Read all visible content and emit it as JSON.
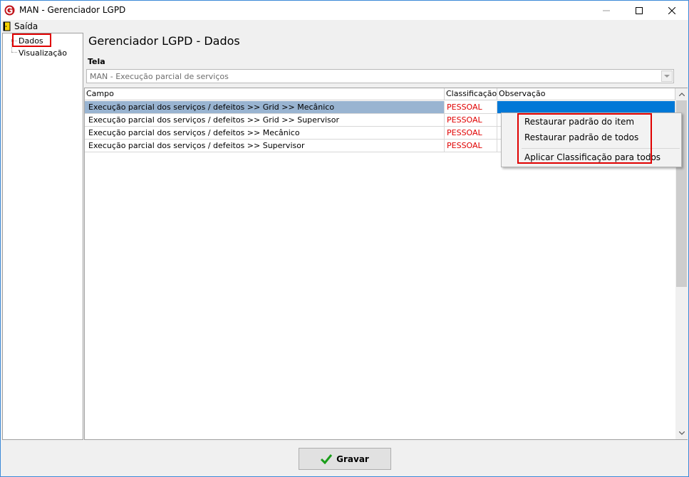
{
  "window": {
    "title": "MAN - Gerenciador LGPD"
  },
  "menubar": {
    "exit_label": "Saída"
  },
  "tree": {
    "items": [
      {
        "label": "Dados"
      },
      {
        "label": "Visualização"
      }
    ]
  },
  "main": {
    "title": "Gerenciador LGPD - Dados",
    "tela_label": "Tela",
    "tela_value": "MAN - Execução parcial de serviços"
  },
  "grid": {
    "columns": [
      "Campo",
      "Classificação",
      "Observação"
    ],
    "rows": [
      {
        "campo": "Execução parcial dos serviços / defeitos >> Grid >> Mecânico",
        "classificacao": "PESSOAL",
        "observacao": ""
      },
      {
        "campo": "Execução parcial dos serviços / defeitos >> Grid >> Supervisor",
        "classificacao": "PESSOAL",
        "observacao": ""
      },
      {
        "campo": "Execução parcial dos serviços / defeitos >> Mecânico",
        "classificacao": "PESSOAL",
        "observacao": ""
      },
      {
        "campo": "Execução parcial dos serviços / defeitos >> Supervisor",
        "classificacao": "PESSOAL",
        "observacao": ""
      }
    ]
  },
  "context_menu": {
    "items": [
      "Restaurar padrão do item",
      "Restaurar padrão de todos",
      "Aplicar Classificação para todos"
    ]
  },
  "footer": {
    "save_label": "Gravar"
  },
  "colors": {
    "accent": "#0078d7",
    "highlight_red": "#e00000",
    "selection_row": "#99b4d1"
  }
}
